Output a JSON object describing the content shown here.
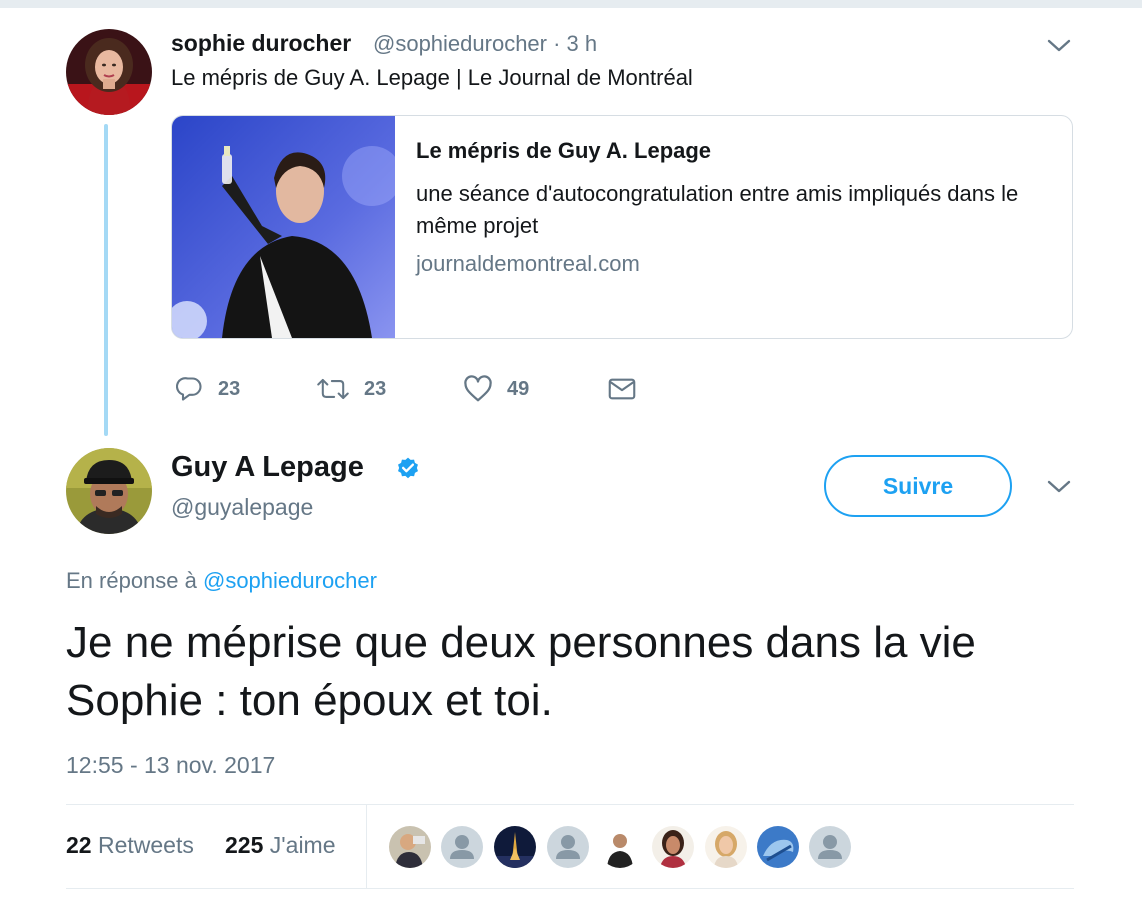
{
  "tweet1": {
    "name": "sophie durocher",
    "handle_time": "@sophiedurocher · 3 h",
    "text": "Le mépris de Guy A. Lepage | Le Journal de Montréal",
    "card": {
      "title": "Le mépris de Guy A. Lepage",
      "description": "une séance d'autocongratulation entre amis impliqués dans le même projet",
      "domain": "journaldemontreal.com"
    },
    "actions": {
      "replies": "23",
      "retweets": "23",
      "likes": "49"
    }
  },
  "tweet2": {
    "name": "Guy A Lepage",
    "handle": "@guyalepage",
    "follow_label": "Suivre",
    "reply_prefix": "En réponse à ",
    "reply_mention": "@sophiedurocher",
    "text": "Je ne méprise que deux personnes dans la vie Sophie : ton époux et toi.",
    "timestamp": "12:55 - 13 nov. 2017",
    "stats": {
      "retweets_count": "22",
      "retweets_label": "Retweets",
      "likes_count": "225",
      "likes_label": "J'aime"
    }
  },
  "colors": {
    "accent": "#1da1f2",
    "secondary_text": "#657786",
    "thread_line": "#a4d9f5",
    "divider": "#e6ecf0"
  },
  "icons": [
    "reply-icon",
    "retweet-icon",
    "like-icon",
    "direct-message-icon",
    "chevron-down-icon",
    "verified-badge-icon",
    "default-avatar-icon"
  ]
}
